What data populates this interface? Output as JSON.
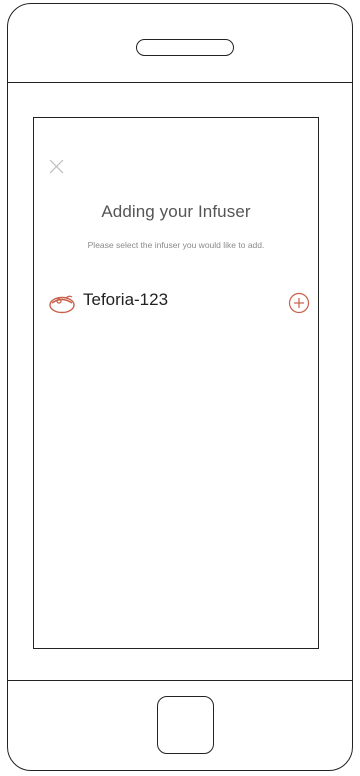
{
  "app": {
    "title": "Adding your Infuser",
    "subtitle": "Please select the infuser you would like to add."
  },
  "devices": [
    {
      "name": "Teforia-123",
      "icon": "teapot-icon",
      "action_icon": "plus-circle-icon"
    }
  ],
  "colors": {
    "accent": "#c8604a",
    "frame": "#222222",
    "title": "#555555",
    "subtitle": "#8a8a8a"
  },
  "icons": {
    "close": "close-icon",
    "device": "teapot-icon",
    "add": "plus-circle-icon"
  }
}
